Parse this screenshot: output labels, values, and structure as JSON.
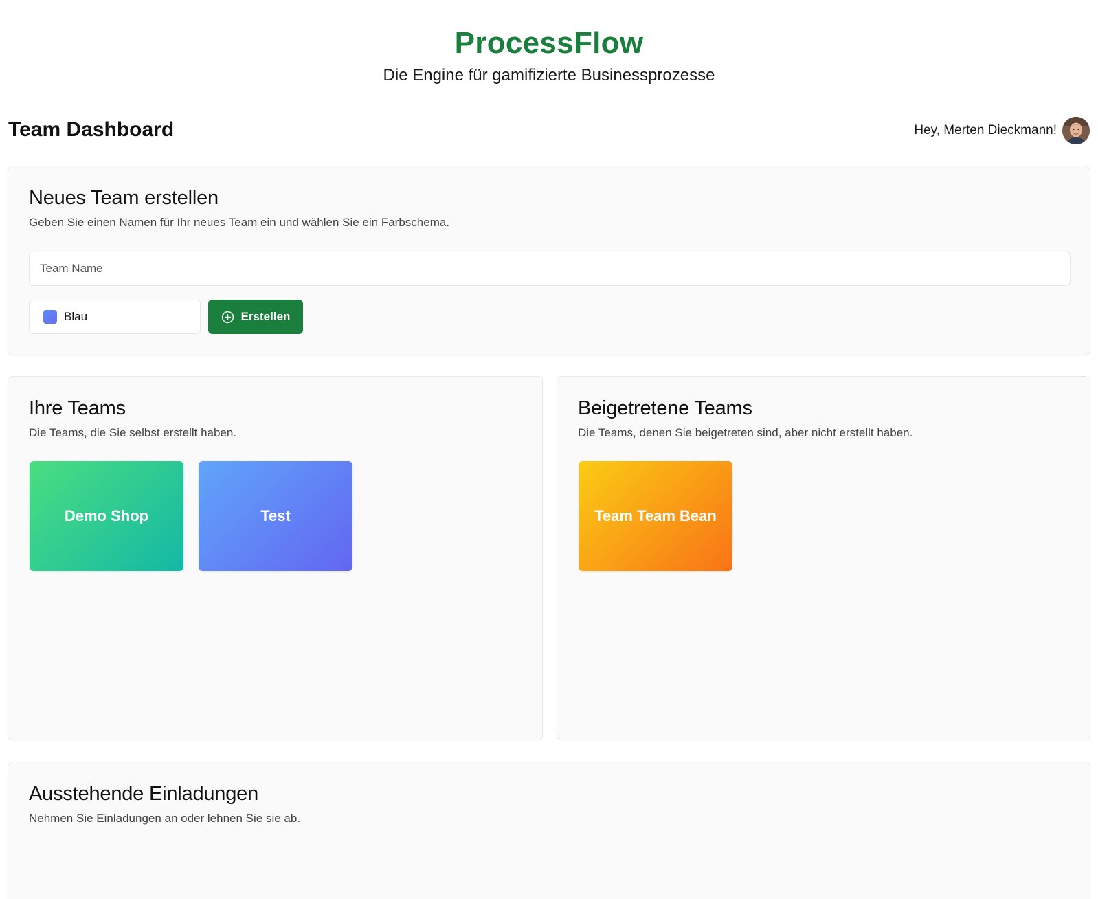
{
  "app": {
    "brand": "ProcessFlow",
    "tagline": "Die Engine für gamifizierte Businessprozesse"
  },
  "header": {
    "title": "Team Dashboard",
    "greeting": "Hey, Merten Dieckmann!"
  },
  "create_team": {
    "title": "Neues Team erstellen",
    "description": "Geben Sie einen Namen für Ihr neues Team ein und wählen Sie ein Farbschema.",
    "name_placeholder": "Team Name",
    "name_value": "",
    "color_selected": "Blau",
    "submit_label": "Erstellen"
  },
  "own_teams": {
    "title": "Ihre Teams",
    "description": "Die Teams, die Sie selbst erstellt haben.",
    "items": [
      {
        "name": "Demo Shop",
        "color": "green"
      },
      {
        "name": "Test",
        "color": "blue"
      }
    ]
  },
  "joined_teams": {
    "title": "Beigetretene Teams",
    "description": "Die Teams, denen Sie beigetreten sind, aber nicht erstellt haben.",
    "items": [
      {
        "name": "Team Team Bean",
        "color": "orange"
      }
    ]
  },
  "invitations": {
    "title": "Ausstehende Einladungen",
    "description": "Nehmen Sie Einladungen an oder lehnen Sie sie ab."
  },
  "colors": {
    "brand": "#1a7f3c",
    "green_from": "#4ade80",
    "green_to": "#14b8a6",
    "blue_from": "#60a5fa",
    "blue_to": "#6366f1",
    "orange_from": "#facc15",
    "orange_to": "#f97316"
  },
  "icons": {
    "create": "plus-circle-icon",
    "avatar": "user-avatar"
  }
}
